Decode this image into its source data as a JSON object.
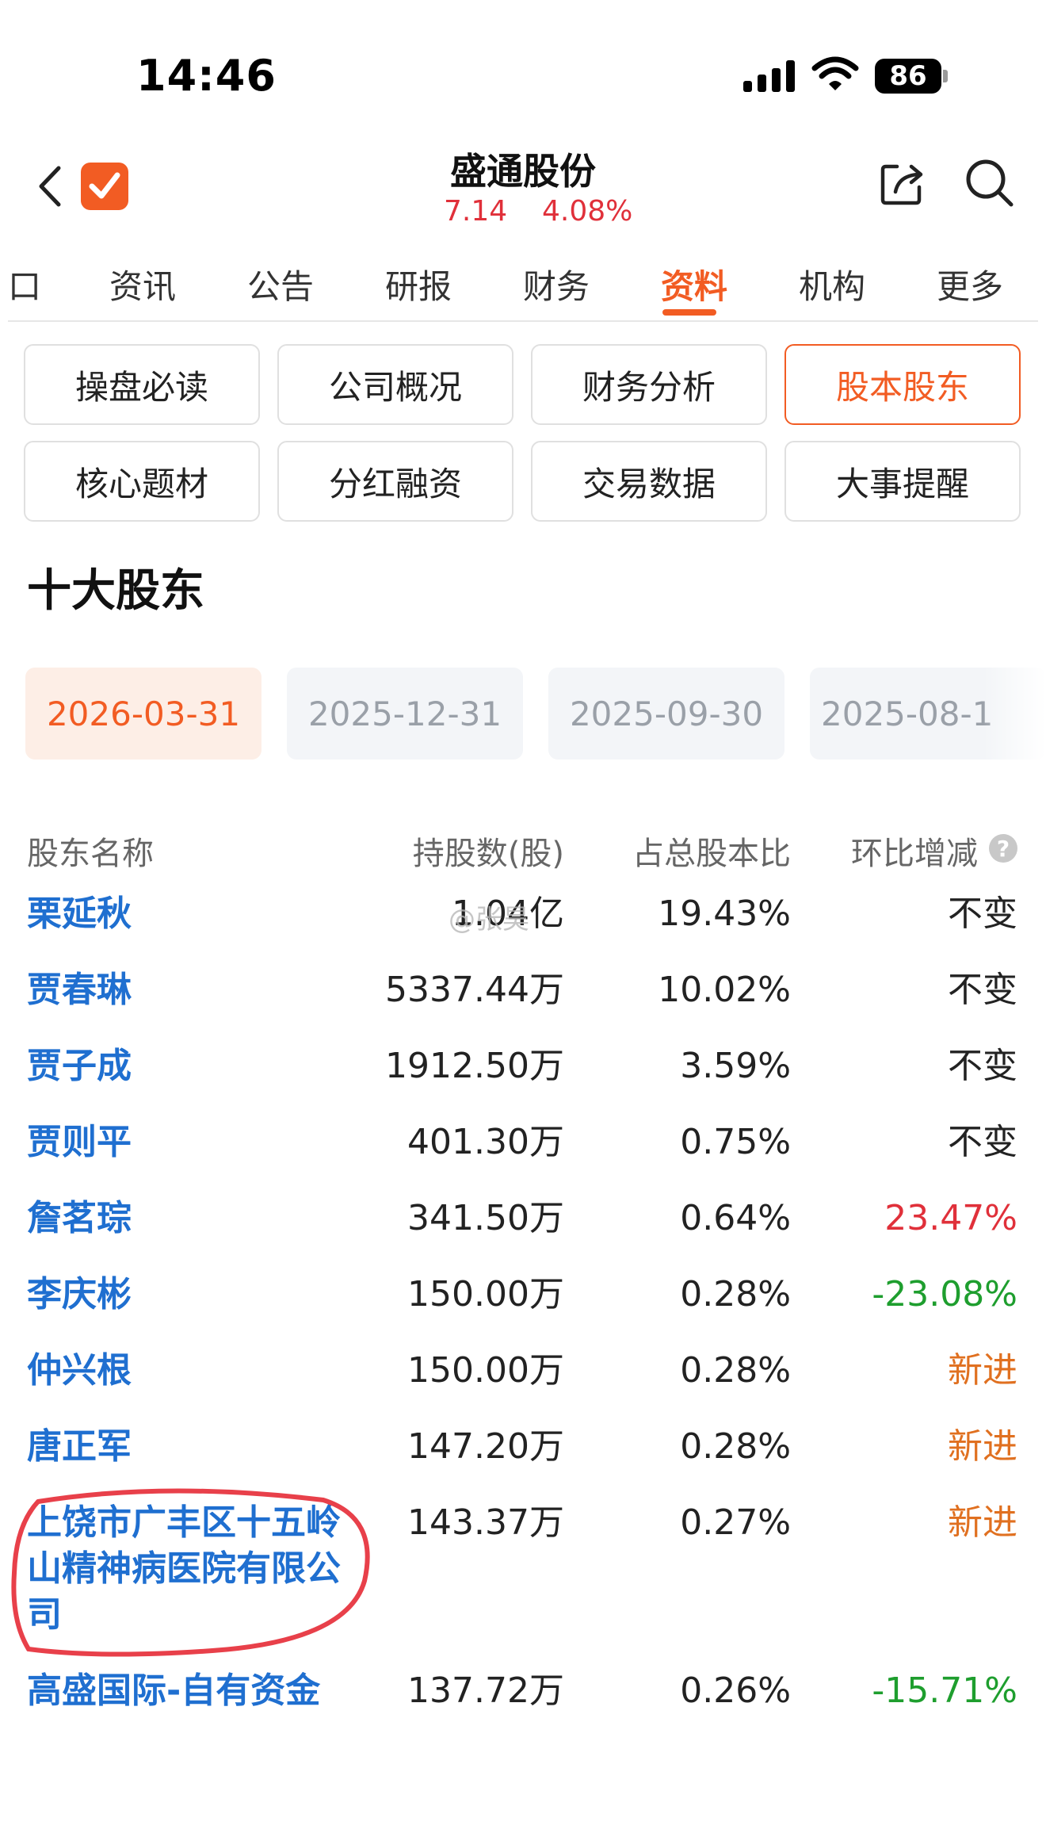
{
  "status_bar": {
    "time": "14:46",
    "battery": "86"
  },
  "header": {
    "stock_name": "盛通股份",
    "price": "7.14",
    "change_pct": "4.08%"
  },
  "tabs": [
    {
      "label": "口",
      "active": false
    },
    {
      "label": "资讯",
      "active": false
    },
    {
      "label": "公告",
      "active": false
    },
    {
      "label": "研报",
      "active": false
    },
    {
      "label": "财务",
      "active": false
    },
    {
      "label": "资料",
      "active": true
    },
    {
      "label": "机构",
      "active": false
    },
    {
      "label": "更多",
      "active": false
    }
  ],
  "categories": [
    {
      "label": "操盘必读",
      "active": false
    },
    {
      "label": "公司概况",
      "active": false
    },
    {
      "label": "财务分析",
      "active": false
    },
    {
      "label": "股本股东",
      "active": true
    },
    {
      "label": "核心题材",
      "active": false
    },
    {
      "label": "分红融资",
      "active": false
    },
    {
      "label": "交易数据",
      "active": false
    },
    {
      "label": "大事提醒",
      "active": false
    }
  ],
  "section_title": "十大股东",
  "dates": [
    {
      "label": "2026-03-31",
      "active": true
    },
    {
      "label": "2025-12-31",
      "active": false
    },
    {
      "label": "2025-09-30",
      "active": false
    },
    {
      "label": "2025-08-1",
      "active": false
    }
  ],
  "table": {
    "headers": {
      "name": "股东名称",
      "shares": "持股数(股)",
      "ratio": "占总股本比",
      "change": "环比增减"
    },
    "help_icon": "?",
    "rows": [
      {
        "name": "栗延秋",
        "shares": "1.04亿",
        "ratio": "19.43%",
        "change": "不变",
        "change_color": "#222222"
      },
      {
        "name": "贾春琳",
        "shares": "5337.44万",
        "ratio": "10.02%",
        "change": "不变",
        "change_color": "#222222"
      },
      {
        "name": "贾子成",
        "shares": "1912.50万",
        "ratio": "3.59%",
        "change": "不变",
        "change_color": "#222222"
      },
      {
        "name": "贾则平",
        "shares": "401.30万",
        "ratio": "0.75%",
        "change": "不变",
        "change_color": "#222222"
      },
      {
        "name": "詹茗琮",
        "shares": "341.50万",
        "ratio": "0.64%",
        "change": "23.47%",
        "change_color": "#e0303a"
      },
      {
        "name": "李庆彬",
        "shares": "150.00万",
        "ratio": "0.28%",
        "change": "-23.08%",
        "change_color": "#1e9e2e"
      },
      {
        "name": "仲兴根",
        "shares": "150.00万",
        "ratio": "0.28%",
        "change": "新进",
        "change_color": "#e07020"
      },
      {
        "name": "唐正军",
        "shares": "147.20万",
        "ratio": "0.28%",
        "change": "新进",
        "change_color": "#e07020"
      },
      {
        "name": "上饶市广丰区十五岭山精神病医院有限公司",
        "shares": "143.37万",
        "ratio": "0.27%",
        "change": "新进",
        "change_color": "#e07020"
      },
      {
        "name": "高盛国际-自有资金",
        "shares": "137.72万",
        "ratio": "0.26%",
        "change": "-15.71%",
        "change_color": "#1e9e2e"
      }
    ]
  },
  "watermark": "@张昊",
  "colors": {
    "accent": "#f25c23",
    "link": "#1f6fd0",
    "up": "#e0303a",
    "down": "#1e9e2e",
    "new": "#e07020",
    "annotation": "#e8404a"
  }
}
